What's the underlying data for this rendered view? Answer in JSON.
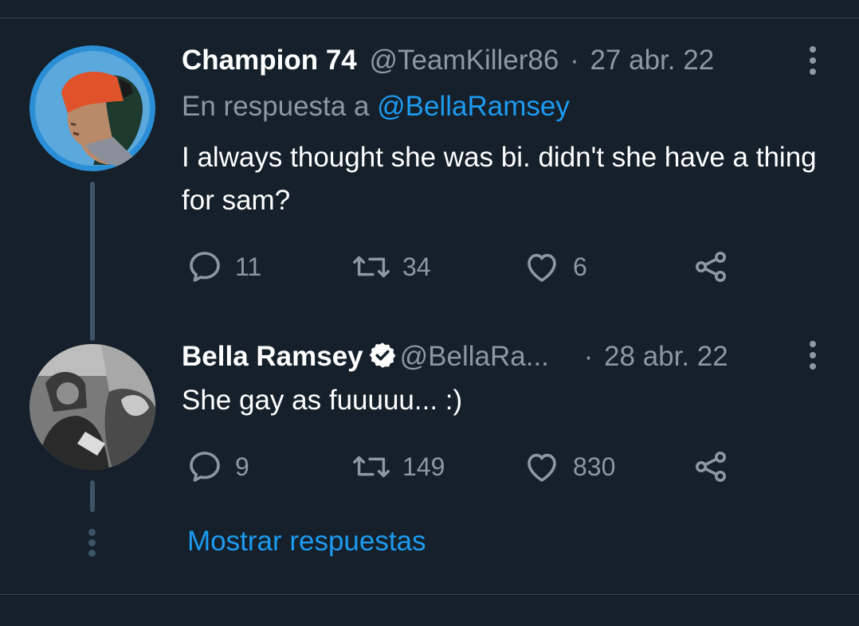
{
  "tweets": [
    {
      "name": "Champion 74",
      "handle": "@TeamKiller86",
      "separator": "·",
      "date": "27 abr. 22",
      "reply_prefix": "En respuesta a ",
      "reply_mention": "@BellaRamsey",
      "text": "I always thought she was bi. didn't she have a thing for sam?",
      "replies": "11",
      "retweets": "34",
      "likes": "6",
      "verified": false
    },
    {
      "name": "Bella Ramsey",
      "handle": "@BellaRa...",
      "separator": "·",
      "date": "28 abr. 22",
      "text": "She gay as fuuuuu... :)",
      "replies": "9",
      "retweets": "149",
      "likes": "830",
      "verified": true
    }
  ],
  "show_replies": "Mostrar respuestas",
  "colors": {
    "background": "#15202b",
    "accent": "#1d9bf0",
    "muted": "#8b98a5",
    "thread_line": "#3d5466"
  },
  "icons": [
    "reply-icon",
    "retweet-icon",
    "like-icon",
    "share-icon",
    "more-icon",
    "verified-badge-icon"
  ]
}
